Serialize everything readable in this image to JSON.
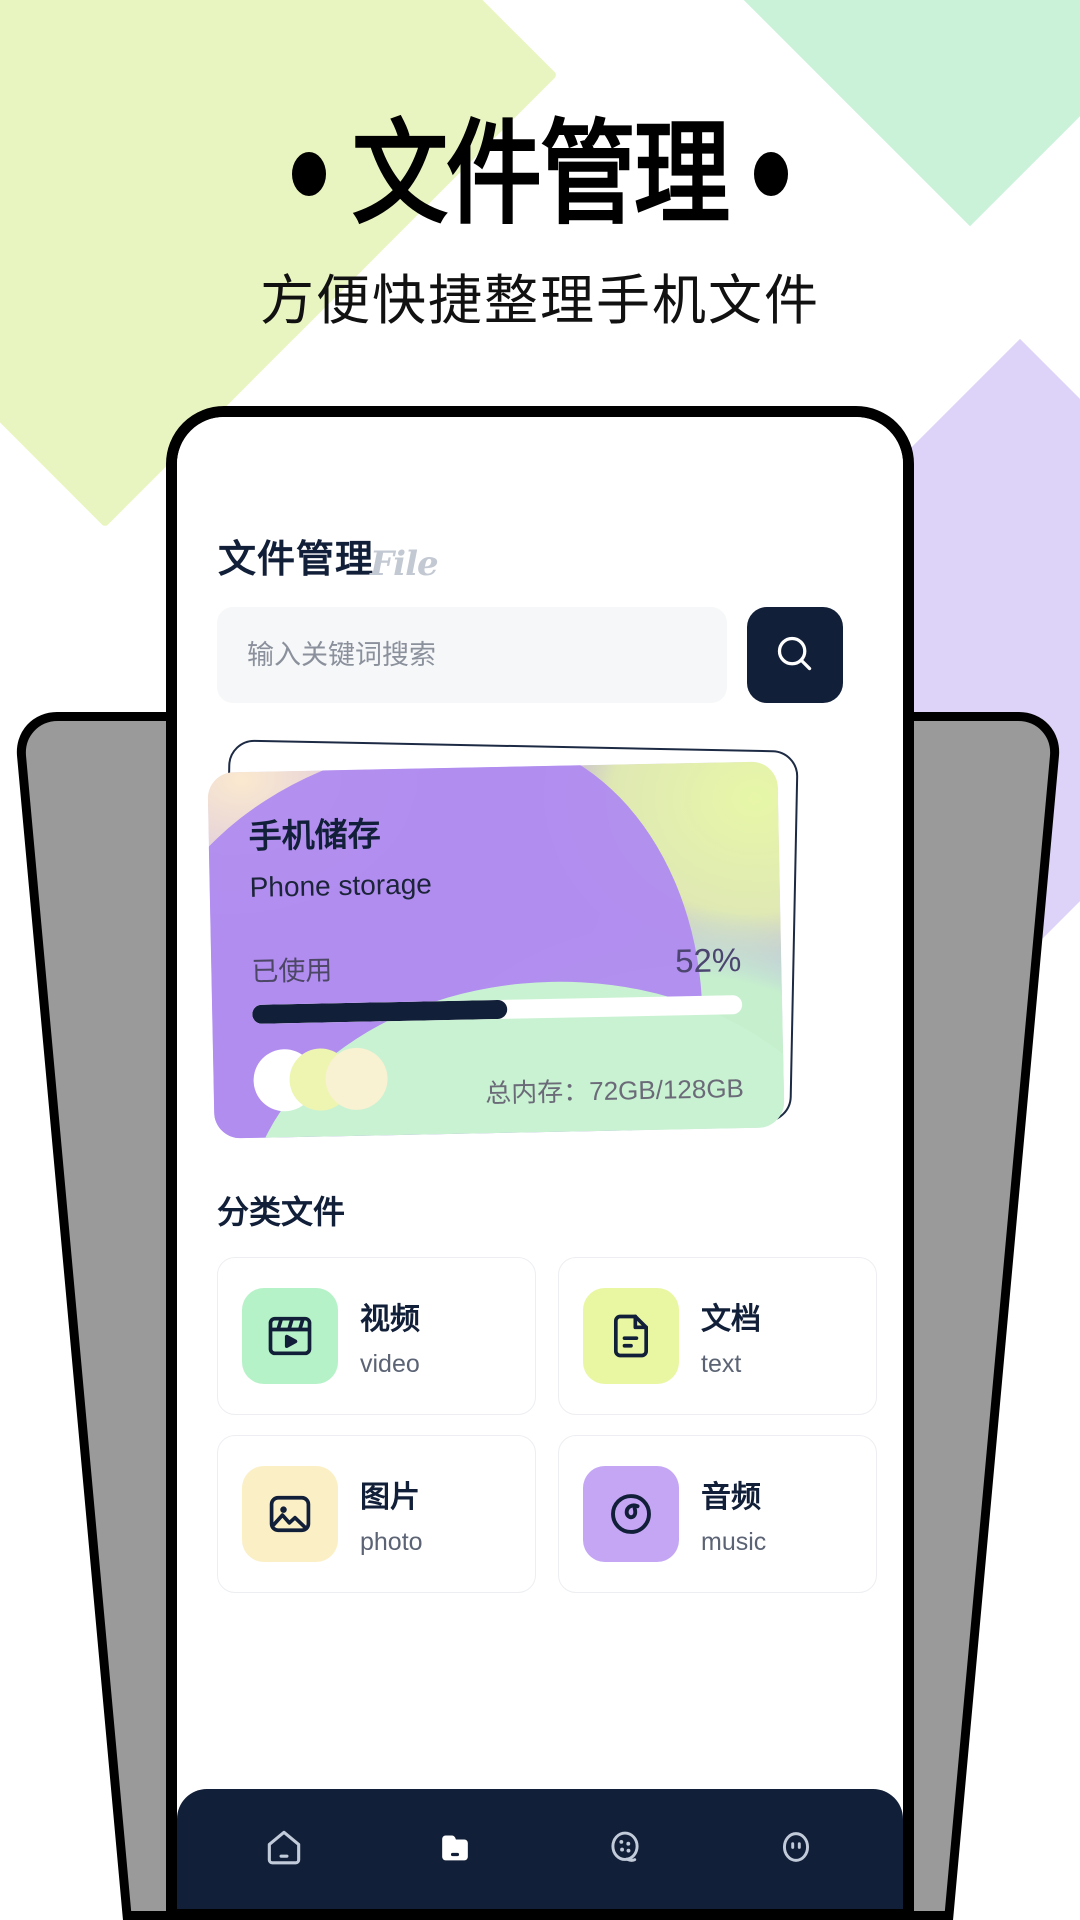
{
  "hero": {
    "title": "文件管理",
    "subtitle": "方便快捷整理手机文件",
    "left_dot": "•",
    "right_dot": "•"
  },
  "app": {
    "title_cn": "文件管理",
    "title_en": "File"
  },
  "search": {
    "placeholder": "输入关键词搜索",
    "value": "",
    "button_icon": "search-icon"
  },
  "storage": {
    "title": "手机储存",
    "subtitle": "Phone storage",
    "used_label": "已使用",
    "used_percent_text": "52%",
    "used_percent": 52,
    "total_text": "总内存：72GB/128GB",
    "used_gb": 72,
    "total_gb": 128,
    "bar_fill_color": "#121f38",
    "bar_track_color": "#ffffff"
  },
  "categories": {
    "heading": "分类文件",
    "items": [
      {
        "name": "视频",
        "en": "video",
        "icon": "film-icon",
        "color": "#b6f2c8"
      },
      {
        "name": "文档",
        "en": "text",
        "icon": "document-icon",
        "color": "#e9f7a3"
      },
      {
        "name": "图片",
        "en": "photo",
        "icon": "image-icon",
        "color": "#fbefc6"
      },
      {
        "name": "音频",
        "en": "music",
        "icon": "disc-icon",
        "color": "#c4a6f5"
      }
    ]
  },
  "bottom_nav": {
    "items": [
      {
        "icon": "home-icon",
        "active": false
      },
      {
        "icon": "folder-icon",
        "active": true
      },
      {
        "icon": "film-reel-icon",
        "active": false
      },
      {
        "icon": "face-icon",
        "active": false
      }
    ],
    "bar_color": "#121f38"
  },
  "theme": {
    "navy": "#121f38",
    "lime_diamond": "#e9f5c0",
    "mint_diamond": "#c9f2d9",
    "purple_diamond": "#ddd2f7",
    "side_phone_gray": "#9a9a9a"
  }
}
